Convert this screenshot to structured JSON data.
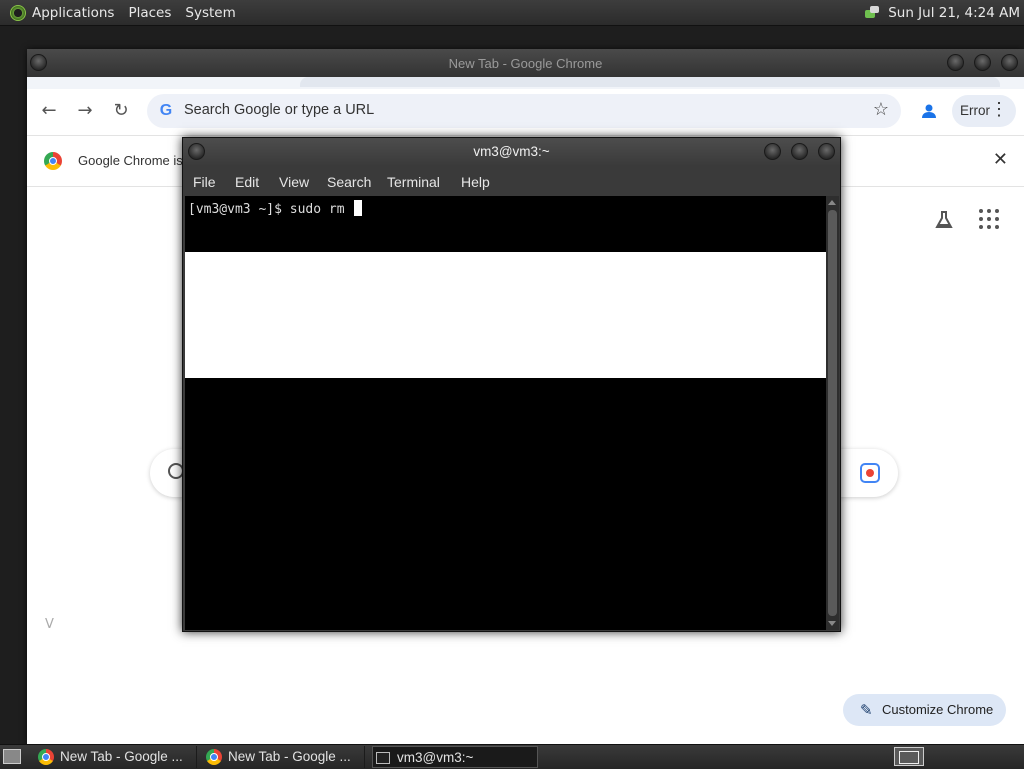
{
  "top_panel": {
    "menus": [
      "Applications",
      "Places",
      "System"
    ],
    "clock": "Sun Jul 21,  4:24 AM"
  },
  "chrome": {
    "window_title": "New Tab - Google Chrome",
    "omnibox_placeholder": "Search Google or type a URL",
    "profile_chip_label": "Error",
    "infobar_message": "Google Chrome isn't",
    "customize_label": "Customize Chrome",
    "left_glyph": "V"
  },
  "terminal": {
    "window_title": "vm3@vm3:~",
    "menus": [
      "File",
      "Edit",
      "View",
      "Search",
      "Terminal",
      "Help"
    ],
    "prompt_line": "[vm3@vm3 ~]$ sudo rm "
  },
  "taskbar": {
    "tasks": [
      {
        "label": "New Tab - Google ...",
        "icon": "chrome-icon"
      },
      {
        "label": "New Tab - Google ...",
        "icon": "chrome-icon"
      },
      {
        "label": "vm3@vm3:~",
        "icon": "terminal-icon"
      }
    ]
  }
}
